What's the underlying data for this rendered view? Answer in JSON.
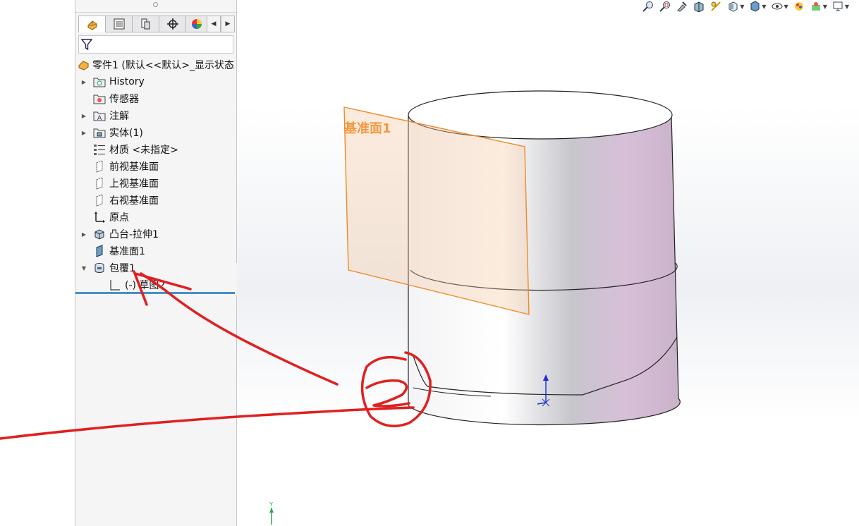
{
  "feature_tree": {
    "root_label": "零件1 (默认<<默认>_显示状态",
    "items": [
      {
        "label": "History",
        "icon": "history-folder-icon",
        "expandable": true
      },
      {
        "label": "传感器",
        "icon": "sensor-folder-icon",
        "expandable": false
      },
      {
        "label": "注解",
        "icon": "annotation-folder-icon",
        "expandable": true
      },
      {
        "label": "实体(1)",
        "icon": "solid-bodies-folder-icon",
        "expandable": true
      },
      {
        "label": "材质 <未指定>",
        "icon": "material-icon",
        "expandable": false
      },
      {
        "label": "前视基准面",
        "icon": "plane-icon",
        "expandable": false
      },
      {
        "label": "上视基准面",
        "icon": "plane-icon",
        "expandable": false
      },
      {
        "label": "右视基准面",
        "icon": "plane-icon",
        "expandable": false
      },
      {
        "label": "原点",
        "icon": "origin-icon",
        "expandable": false
      },
      {
        "label": "凸台-拉伸1",
        "icon": "boss-extrude-icon",
        "expandable": true
      },
      {
        "label": "基准面1",
        "icon": "plane-icon",
        "expandable": false
      },
      {
        "label": "包覆1",
        "icon": "wrap-feature-icon",
        "expandable": true,
        "expanded": true
      },
      {
        "label": "(-) 草图2",
        "icon": "sketch-icon",
        "expandable": false,
        "child": true
      }
    ]
  },
  "tabs": [
    {
      "name": "feature-manager",
      "icon": "feature-manager-icon",
      "active": true
    },
    {
      "name": "property-manager",
      "icon": "property-manager-icon"
    },
    {
      "name": "configuration-manager",
      "icon": "configuration-manager-icon"
    },
    {
      "name": "dim-xpert-manager",
      "icon": "dimxpert-icon"
    },
    {
      "name": "display-manager",
      "icon": "display-manager-icon"
    }
  ],
  "viewport": {
    "plane_label": "基准面1",
    "triad_label": "Y"
  },
  "colors": {
    "plane_orange": "#f08a24",
    "annotation_red": "#e02020",
    "selection_blue": "#4a8fc6",
    "triad_blue": "#1a2fd0",
    "triad_green": "#2aa84a"
  }
}
